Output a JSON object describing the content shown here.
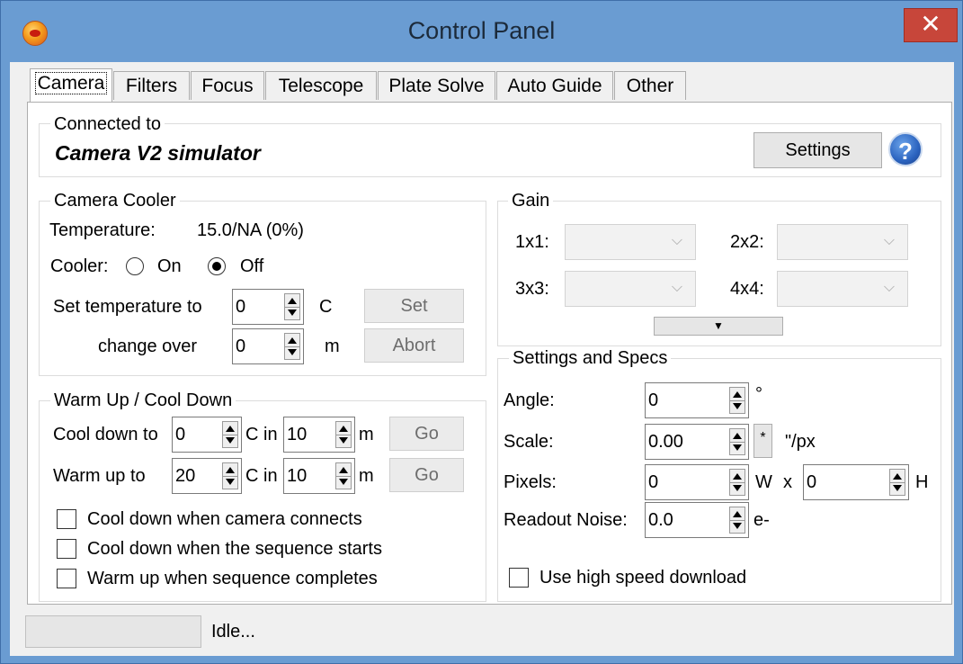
{
  "window": {
    "title": "Control Panel",
    "close_glyph": "✕"
  },
  "tabs": [
    {
      "label": "Camera"
    },
    {
      "label": "Filters"
    },
    {
      "label": "Focus"
    },
    {
      "label": "Telescope"
    },
    {
      "label": "Plate Solve"
    },
    {
      "label": "Auto Guide"
    },
    {
      "label": "Other"
    }
  ],
  "connected": {
    "group_label": "Connected to",
    "device_name": "Camera V2 simulator",
    "settings_button": "Settings",
    "help_glyph": "?"
  },
  "cooler": {
    "group_label": "Camera Cooler",
    "temperature_label": "Temperature:",
    "temperature_value": "15.0/NA (0%)",
    "cooler_label": "Cooler:",
    "on_label": "On",
    "off_label": "Off",
    "set_temp_label": "Set temperature to",
    "set_temp_value": "0",
    "set_temp_unit": "C",
    "set_button": "Set",
    "change_over_label": "change over",
    "change_over_value": "0",
    "change_over_unit": "m",
    "abort_button": "Abort"
  },
  "warm": {
    "group_label": "Warm Up / Cool Down",
    "cool_down_label": "Cool down to",
    "cool_down_value": "0",
    "cool_down_minutes": "10",
    "warm_up_label": "Warm up to",
    "warm_up_value": "20",
    "warm_up_minutes": "10",
    "c_in_label": "C in",
    "m_label": "m",
    "go_button": "Go",
    "checkbox_1": "Cool down when camera connects",
    "checkbox_2": "Cool down when the sequence starts",
    "checkbox_3": "Warm up when sequence completes"
  },
  "gain": {
    "group_label": "Gain",
    "label_1x1": "1x1:",
    "label_2x2": "2x2:",
    "label_3x3": "3x3:",
    "label_4x4": "4x4:",
    "chevron": "⌵",
    "expand_glyph": "▼"
  },
  "specs": {
    "group_label": "Settings and Specs",
    "angle_label": "Angle:",
    "angle_value": "0",
    "angle_unit": "°",
    "scale_label": "Scale:",
    "scale_value": "0.00",
    "scale_unit": "\"/px",
    "scale_button": "*",
    "pixels_label": "Pixels:",
    "pixels_w": "0",
    "w_label": "W",
    "x_label": "x",
    "pixels_h": "0",
    "h_label": "H",
    "noise_label": "Readout Noise:",
    "noise_value": "0.0",
    "noise_unit": "e-",
    "high_speed_label": "Use high speed download"
  },
  "status": {
    "text": "Idle..."
  }
}
